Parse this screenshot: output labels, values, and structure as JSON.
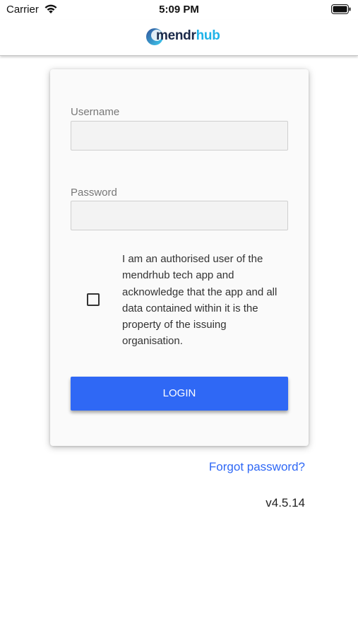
{
  "status_bar": {
    "carrier": "Carrier",
    "time": "5:09 PM"
  },
  "header": {
    "logo_text_primary": "mendr",
    "logo_text_secondary": "hub"
  },
  "form": {
    "username_label": "Username",
    "username_value": "",
    "password_label": "Password",
    "password_value": "",
    "agreement_checked": false,
    "agreement_text": "I am an authorised user of the mendrhub tech app and acknowledge that the app and all data contained within it is the property of the issuing organisation.",
    "login_label": "LOGIN"
  },
  "footer": {
    "forgot_password": "Forgot password?",
    "version": "v4.5.14"
  },
  "colors": {
    "accent": "#2f68f5",
    "logo_dark": "#1b2a4a",
    "logo_light": "#1fb3e8"
  }
}
